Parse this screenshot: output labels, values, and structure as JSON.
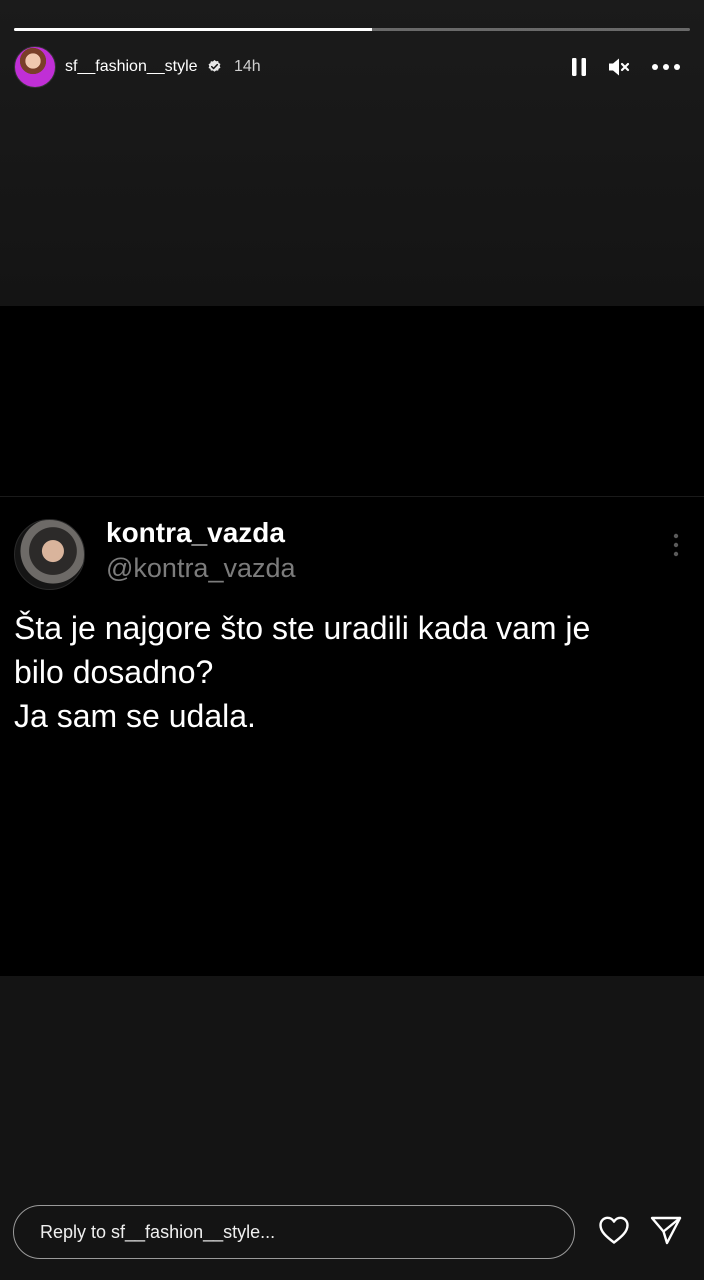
{
  "story": {
    "progress": 0.53,
    "username": "sf__fashion__style",
    "time": "14h",
    "icons": {
      "avatar": "profile-avatar",
      "verified": "verified-badge-icon",
      "pause": "pause-icon",
      "mute": "mute-icon",
      "more": "more-icon"
    }
  },
  "tweet": {
    "name": "kontra_vazda",
    "handle": "@kontra_vazda",
    "line1": "Šta je najgore što ste uradili kada vam je",
    "line2": "bilo dosadno?",
    "line3": "Ja sam se udala."
  },
  "reply": {
    "placeholder": "Reply to sf__fashion__style..."
  },
  "colors": {
    "background": "#141414",
    "card": "#000000",
    "handle": "#7c7c7c"
  }
}
